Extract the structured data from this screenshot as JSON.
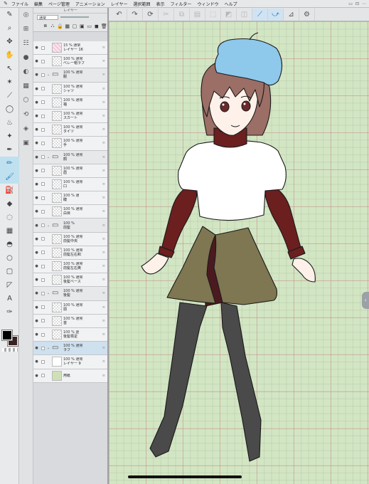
{
  "menu": {
    "items": [
      "ファイル",
      "編集",
      "ページ管理",
      "アニメーション",
      "レイヤー",
      "選択範囲",
      "表示",
      "フィルター",
      "ウィンドウ",
      "ヘルプ"
    ]
  },
  "layer_panel": {
    "title": "レイヤー",
    "blend_mode": "通常",
    "layers": [
      {
        "kind": "layer",
        "thumb": "pink",
        "line1": "15 % 通常",
        "line2": "レイヤー 16"
      },
      {
        "kind": "layer",
        "thumb": "check",
        "line1": "100 % 通常",
        "line2": "ベレー帽ラフ"
      },
      {
        "kind": "folder",
        "thumb": "folder",
        "line1": "100 % 通常",
        "line2": "服"
      },
      {
        "kind": "layer",
        "thumb": "check",
        "line1": "100 % 通常",
        "line2": "シャツ"
      },
      {
        "kind": "layer",
        "thumb": "check",
        "line1": "100 % 通常",
        "line2": "袖"
      },
      {
        "kind": "layer",
        "thumb": "check",
        "line1": "100 % 通常",
        "line2": "スカート"
      },
      {
        "kind": "layer",
        "thumb": "check",
        "line1": "100 % 通常",
        "line2": "タイツ"
      },
      {
        "kind": "layer",
        "thumb": "check",
        "line1": "100 % 通常",
        "line2": "手"
      },
      {
        "kind": "folder",
        "thumb": "folder",
        "line1": "100 % 通常",
        "line2": "顔"
      },
      {
        "kind": "layer",
        "thumb": "check",
        "line1": "100 % 通常",
        "line2": "眉"
      },
      {
        "kind": "layer",
        "thumb": "check",
        "line1": "100 % 通常",
        "line2": "口"
      },
      {
        "kind": "layer",
        "thumb": "check",
        "line1": "100 % 通",
        "line2": "睫"
      },
      {
        "kind": "layer",
        "thumb": "check",
        "line1": "100 % 通常",
        "line2": "白目"
      },
      {
        "kind": "folder",
        "thumb": "folder",
        "line1": "100 %",
        "line2": "前髪"
      },
      {
        "kind": "layer",
        "thumb": "check",
        "line1": "100 % 通常",
        "line2": "前髪中央"
      },
      {
        "kind": "layer",
        "thumb": "check",
        "line1": "100 % 通常",
        "line2": "前髪左右和"
      },
      {
        "kind": "layer",
        "thumb": "check",
        "line1": "100 % 通常",
        "line2": "前髪左右奥"
      },
      {
        "kind": "layer",
        "thumb": "check",
        "line1": "100 % 通常",
        "line2": "後髪ベース"
      },
      {
        "kind": "folder",
        "thumb": "folder",
        "line1": "100 % 通常",
        "line2": "後髪"
      },
      {
        "kind": "layer",
        "thumb": "check",
        "line1": "100 % 通常",
        "line2": "頭"
      },
      {
        "kind": "layer",
        "thumb": "check",
        "line1": "100 % 通常",
        "line2": "首"
      },
      {
        "kind": "layer",
        "thumb": "check",
        "line1": "100 % 遅",
        "line2": "後髪標足"
      },
      {
        "kind": "folder",
        "thumb": "folder",
        "line1": "100 % 通常",
        "line2": "ラフ",
        "selected": true
      },
      {
        "kind": "layer",
        "thumb": "white",
        "line1": "100 % 通常",
        "line2": "レイヤー 9"
      },
      {
        "kind": "layer",
        "thumb": "green",
        "line1": "",
        "line2": "用紙"
      }
    ]
  },
  "icons": {
    "tools": [
      "app-icon",
      "zoom-icon",
      "move-icon",
      "hand-icon",
      "select-layer-icon",
      "wand-icon",
      "eyedropper-icon",
      "lasso-icon",
      "bucket-icon",
      "blend-icon",
      "pen-icon",
      "pencil-icon",
      "brush-icon",
      "airbrush-icon",
      "fill-icon",
      "eraser-icon",
      "lasso-select-icon",
      "gradient-icon",
      "figure-icon",
      "frame-icon",
      "ruler-icon",
      "text-icon",
      "balloon-icon",
      "line-correct-icon"
    ],
    "toolbar": [
      "undo-icon",
      "redo-icon",
      "sync-icon",
      "cut-icon",
      "copy-icon",
      "paste-icon",
      "transform-icon",
      "fill-sel-icon",
      "stroke-icon",
      "snap-ruler-icon",
      "snap-special-icon",
      "snap-grid-icon",
      "settings-icon"
    ]
  },
  "colors": {
    "main": "#000000",
    "sub": "#3a2020",
    "canvas_bg": "#d3e6c4",
    "beret": "#8ec8ea",
    "hair": "#9b6e66",
    "turtleneck": "#6b1f1f",
    "skirt": "#7f7652",
    "tights": "#4a4a4a",
    "skin": "#fdf1ea"
  }
}
